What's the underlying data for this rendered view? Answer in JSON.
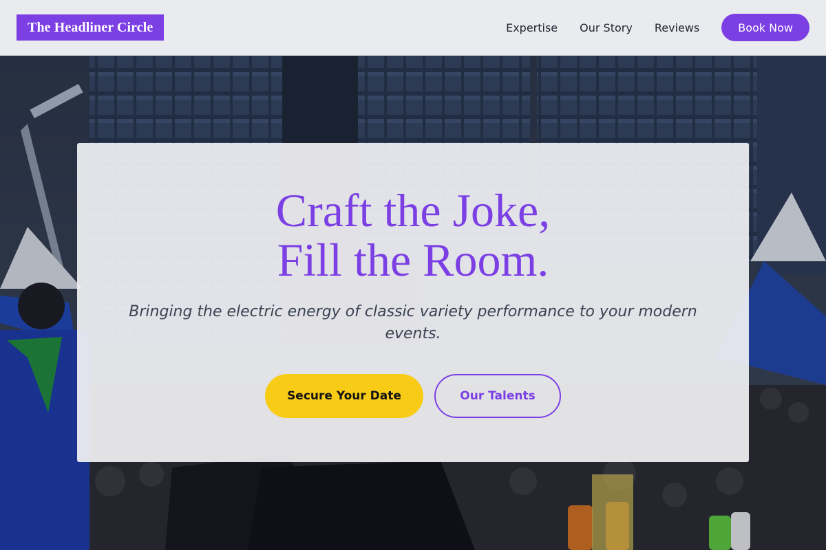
{
  "header": {
    "brand": "The Headliner Circle",
    "nav": [
      {
        "label": "Expertise"
      },
      {
        "label": "Our Story"
      },
      {
        "label": "Reviews"
      }
    ],
    "cta_label": "Book Now"
  },
  "hero": {
    "title_line1": "Craft the Joke,",
    "title_line2": "Fill the Room.",
    "subtitle": "Bringing the electric energy of classic variety performance to your modern events.",
    "primary_label": "Secure Your Date",
    "secondary_label": "Our Talents"
  },
  "colors": {
    "brand_purple": "#7b3fe4",
    "cta_yellow": "#f8cb16",
    "header_bg": "#e9ebee"
  }
}
